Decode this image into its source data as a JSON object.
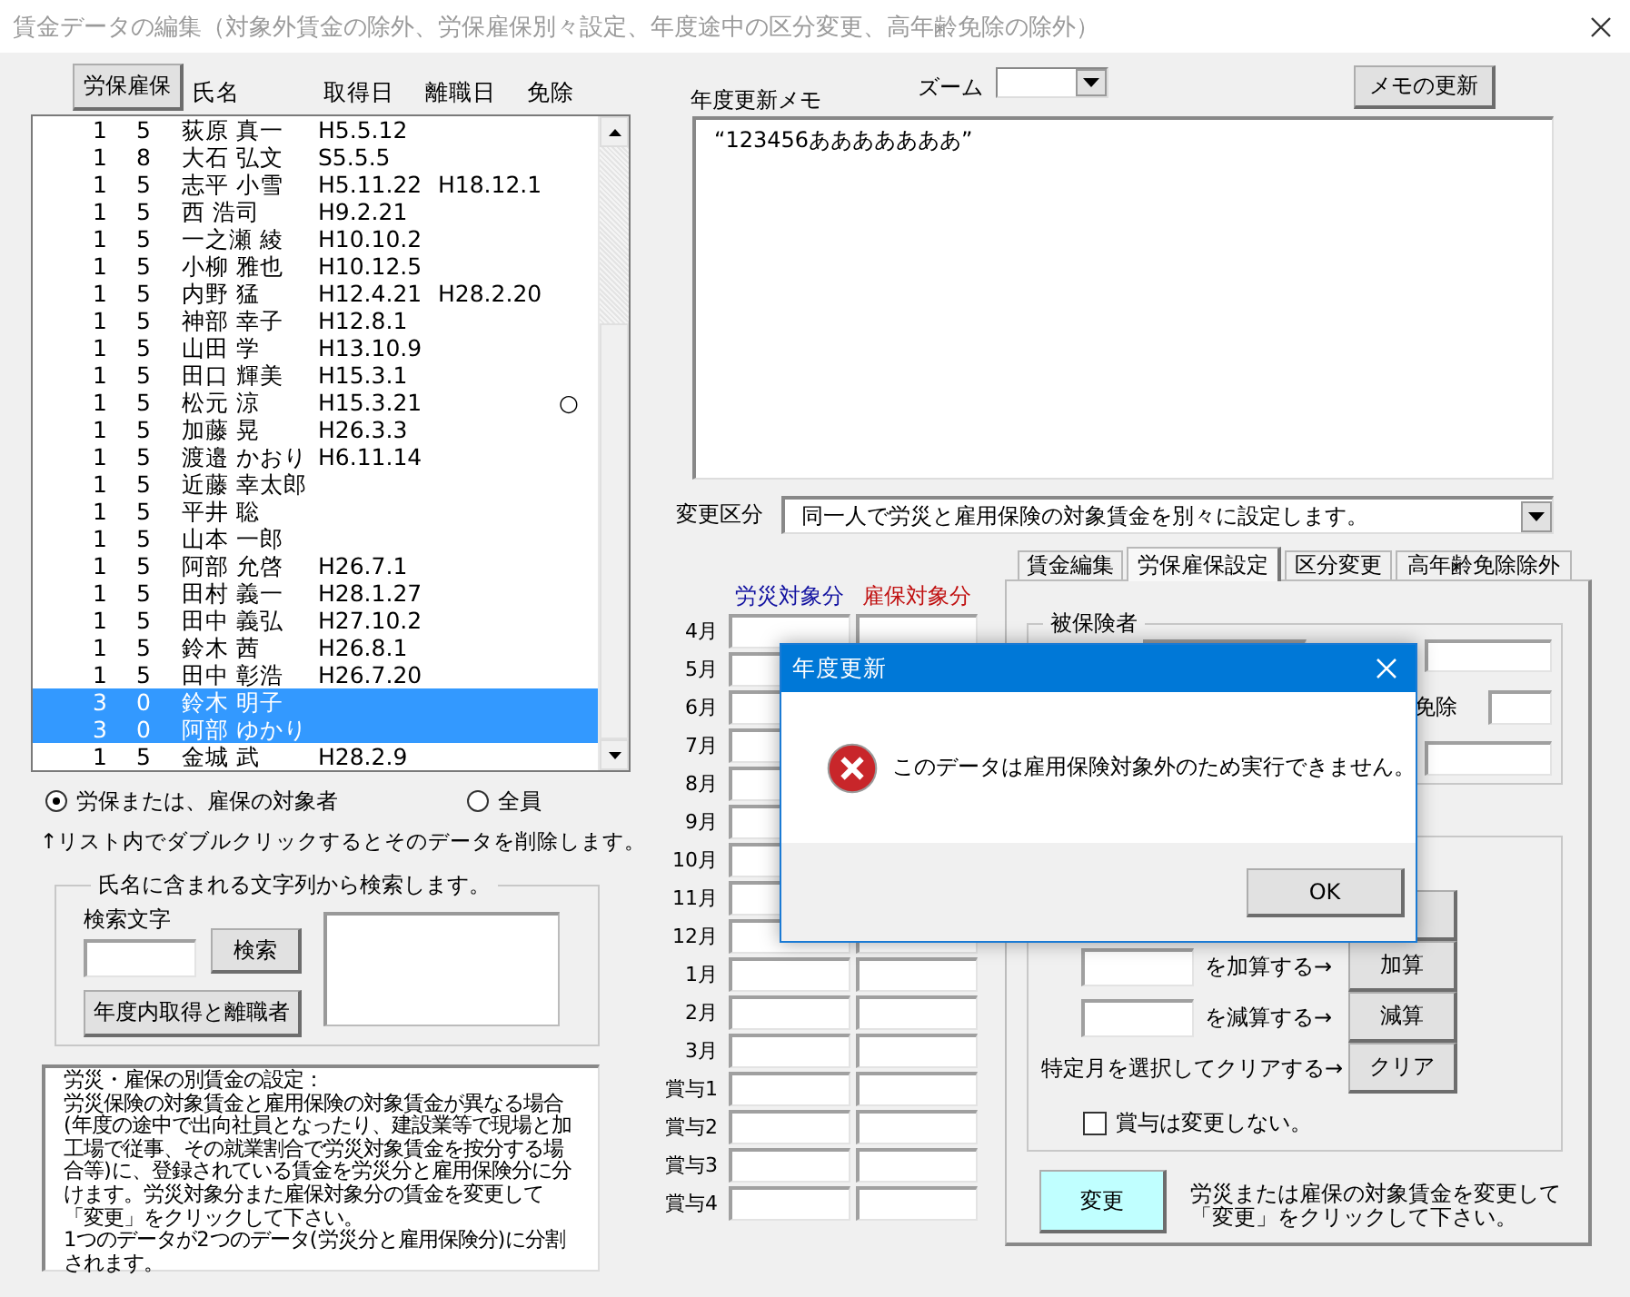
{
  "window": {
    "title": "賃金データの編集（対象外賃金の除外、労保雇保別々設定、年度途中の区分変更、高年齢免除の除外）"
  },
  "employees": {
    "filter_button": "労保雇保",
    "columns": [
      "氏名",
      "取得日",
      "離職日",
      "免除"
    ],
    "rows": [
      {
        "code_1": "1",
        "code_2": "5",
        "name": "荻原 真一",
        "acquired": "H5.5.12",
        "selected": false
      },
      {
        "code_1": "1",
        "code_2": "8",
        "name": "大石 弘文",
        "acquired": "S5.5.5",
        "selected": false
      },
      {
        "code_1": "1",
        "code_2": "5",
        "name": "志平 小雪",
        "acquired": "H5.11.22",
        "left": "H18.12.1",
        "selected": false
      },
      {
        "code_1": "1",
        "code_2": "5",
        "name": "西 浩司",
        "acquired": "H9.2.21",
        "selected": false
      },
      {
        "code_1": "1",
        "code_2": "5",
        "name": "一之瀬 綾",
        "acquired": "H10.10.2",
        "selected": false
      },
      {
        "code_1": "1",
        "code_2": "5",
        "name": "小柳 雅也",
        "acquired": "H10.12.5",
        "selected": false
      },
      {
        "code_1": "1",
        "code_2": "5",
        "name": "内野 猛",
        "acquired": "H12.4.21",
        "left": "H28.2.20",
        "selected": false
      },
      {
        "code_1": "1",
        "code_2": "5",
        "name": "神部 幸子",
        "acquired": "H12.8.1",
        "selected": false
      },
      {
        "code_1": "1",
        "code_2": "5",
        "name": "山田 学",
        "acquired": "H13.10.9",
        "selected": false
      },
      {
        "code_1": "1",
        "code_2": "5",
        "name": "田口 輝美",
        "acquired": "H15.3.1",
        "selected": false
      },
      {
        "code_1": "1",
        "code_2": "5",
        "name": "松元 涼",
        "acquired": "H15.3.21",
        "exempt": "○",
        "selected": false
      },
      {
        "code_1": "1",
        "code_2": "5",
        "name": "加藤 晃",
        "acquired": "H26.3.3",
        "selected": false
      },
      {
        "code_1": "1",
        "code_2": "5",
        "name": "渡邉 かおり",
        "acquired": "H6.11.14",
        "selected": false
      },
      {
        "code_1": "1",
        "code_2": "5",
        "name": "近藤 幸太郎",
        "selected": false
      },
      {
        "code_1": "1",
        "code_2": "5",
        "name": "平井 聡",
        "selected": false
      },
      {
        "code_1": "1",
        "code_2": "5",
        "name": "山本 一郎",
        "selected": false
      },
      {
        "code_1": "1",
        "code_2": "5",
        "name": "阿部 允啓",
        "acquired": "H26.7.1",
        "selected": false
      },
      {
        "code_1": "1",
        "code_2": "5",
        "name": "田村 義一",
        "acquired": "H28.1.27",
        "selected": false
      },
      {
        "code_1": "1",
        "code_2": "5",
        "name": "田中 義弘",
        "acquired": "H27.10.2",
        "selected": false
      },
      {
        "code_1": "1",
        "code_2": "5",
        "name": "鈴木 茜",
        "acquired": "H26.8.1",
        "selected": false
      },
      {
        "code_1": "1",
        "code_2": "5",
        "name": "田中 彰浩",
        "acquired": "H26.7.20",
        "selected": false
      },
      {
        "code_1": "3",
        "code_2": "0",
        "name": "鈴木 明子",
        "selected": true
      },
      {
        "code_1": "3",
        "code_2": "0",
        "name": "阿部 ゆかり",
        "selected": true
      },
      {
        "code_1": "1",
        "code_2": "5",
        "name": "金城 武",
        "acquired": "H28.2.9",
        "selected": false
      }
    ],
    "scope_options": [
      {
        "label": "労保または、雇保の対象者",
        "selected": true
      },
      {
        "label": "全員",
        "selected": false
      }
    ],
    "hint": "↑リスト内でダブルクリックするとそのデータを削除します。",
    "search": {
      "legend": "氏名に含まれる文字列から検索します。",
      "label": "検索文字",
      "button": "検索",
      "recent_button": "年度内取得と離職者"
    },
    "info": [
      "労災・雇保の別賃金の設定：",
      "労災保険の対象賃金と雇用保険の対象賃金が異なる場合(年度の途中で出向社員となったり、建設業等で現場と加工場で従事、その就業割合で労災対象賃金を按分する場合等)に、登録されている賃金を労災分と雇用保険分に分けます。労災対象分また雇保対象分の賃金を変更して「変更」をクリックして下さい。",
      "1つのデータが2つのデータ(労災分と雇用保険分)に分割されます。"
    ]
  },
  "memo": {
    "label": "年度更新メモ",
    "zoom_label": "ズーム",
    "update_button": "メモの更新",
    "text": "“123456あああああああ”"
  },
  "change_type": {
    "label": "変更区分",
    "value": "同一人で労災と雇用保険の対象賃金を別々に設定します。"
  },
  "wage_table": {
    "columns": [
      {
        "label": "労災対象分",
        "color": "#1010a0"
      },
      {
        "label": "雇保対象分",
        "color": "#c01010"
      }
    ],
    "rows": [
      "4月",
      "5月",
      "6月",
      "7月",
      "8月",
      "9月",
      "10月",
      "11月",
      "12月",
      "1月",
      "2月",
      "3月",
      "賞与1",
      "賞与2",
      "賞与3",
      "賞与4"
    ]
  },
  "tabs": [
    {
      "label": "賃金編集",
      "selected": false
    },
    {
      "label": "労保雇保設定",
      "selected": true
    },
    {
      "label": "区分変更",
      "selected": false
    },
    {
      "label": "高年齢免除除外",
      "selected": false
    }
  ],
  "insured": {
    "legend": "被保険者",
    "exempt_label": "免除"
  },
  "adjust": {
    "rows": [
      {
        "kind": "add",
        "label": "を加算する→",
        "button": "加算"
      },
      {
        "kind": "subtract",
        "label": "を減算する→",
        "button": "減算"
      },
      {
        "kind": "clear",
        "label": "特定月を選択してクリアする→",
        "button": "クリア"
      }
    ],
    "bonus_checkbox": {
      "label": "賞与は変更しない。",
      "checked": false
    }
  },
  "apply": {
    "button": "変更",
    "hint": "労災または雇保の対象賃金を変更して「変更」をクリックして下さい。"
  },
  "dialog": {
    "title": "年度更新",
    "message": "このデータは雇用保険対象外のため実行できません。",
    "button": "OK"
  }
}
